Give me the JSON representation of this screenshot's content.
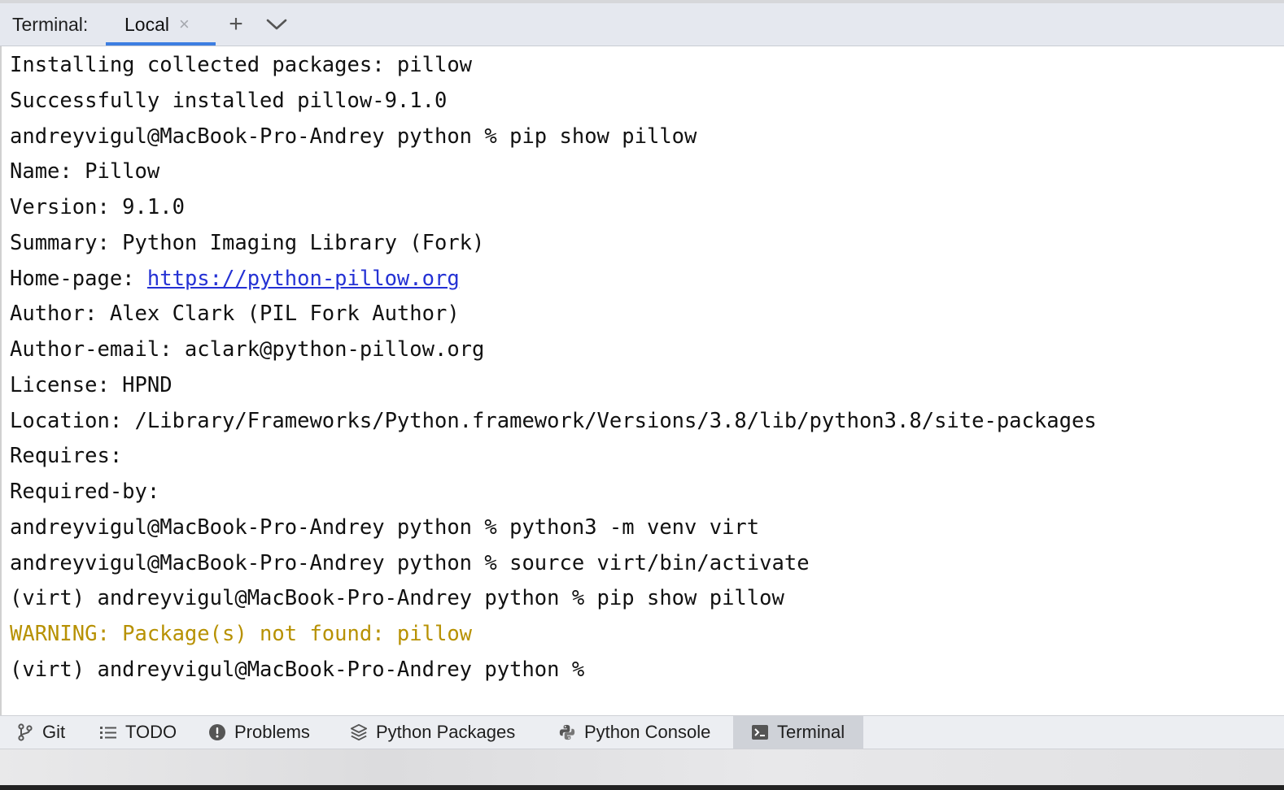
{
  "header": {
    "terminal_label": "Terminal:",
    "tab_label": "Local",
    "close_glyph": "×",
    "add_glyph": "+"
  },
  "terminal": {
    "lines": [
      {
        "text": "Installing collected packages: pillow"
      },
      {
        "text": "Successfully installed pillow-9.1.0"
      },
      {
        "text": "andreyvigul@MacBook-Pro-Andrey python % pip show pillow"
      },
      {
        "text": "Name: Pillow"
      },
      {
        "text": "Version: 9.1.0"
      },
      {
        "text": "Summary: Python Imaging Library (Fork)"
      },
      {
        "prefix": "Home-page: ",
        "link": "https://python-pillow.org"
      },
      {
        "text": "Author: Alex Clark (PIL Fork Author)"
      },
      {
        "text": "Author-email: aclark@python-pillow.org"
      },
      {
        "text": "License: HPND"
      },
      {
        "text": "Location: /Library/Frameworks/Python.framework/Versions/3.8/lib/python3.8/site-packages"
      },
      {
        "text": "Requires:"
      },
      {
        "text": "Required-by:"
      },
      {
        "text": "andreyvigul@MacBook-Pro-Andrey python % python3 -m venv virt"
      },
      {
        "text": "andreyvigul@MacBook-Pro-Andrey python % source virt/bin/activate"
      },
      {
        "text": "(virt) andreyvigul@MacBook-Pro-Andrey python % pip show pillow"
      },
      {
        "text": "WARNING: Package(s) not found: pillow",
        "style": "warning"
      },
      {
        "text": "(virt) andreyvigul@MacBook-Pro-Andrey python % "
      }
    ],
    "link_color": "#2431d4",
    "warning_color": "#b79102"
  },
  "toolwindows": {
    "git": {
      "label": "Git",
      "icon": "git-branch-icon"
    },
    "todo": {
      "label": "TODO",
      "icon": "list-icon"
    },
    "problems": {
      "label": "Problems",
      "icon": "alert-circle-icon"
    },
    "python_packages": {
      "label": "Python Packages",
      "icon": "layers-icon"
    },
    "python_console": {
      "label": "Python Console",
      "icon": "python-icon"
    },
    "terminal": {
      "label": "Terminal",
      "icon": "terminal-icon",
      "active": true
    }
  },
  "colors": {
    "accent": "#3d7ee1",
    "header_bg": "#e5e8ef",
    "statusbar_bg": "#eceef2",
    "active_tool_bg": "#cfd2d8"
  }
}
